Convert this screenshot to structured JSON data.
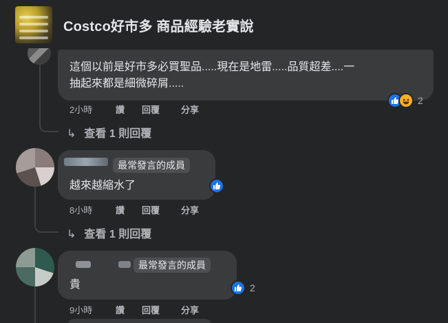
{
  "header": {
    "group_name": "Costco好市多 商品經驗老實說"
  },
  "comments": [
    {
      "text_lines": [
        "這個以前是好市多必買聖品.....現在是地雷.....品質超差....一",
        "抽起來都是細微碎屑....."
      ],
      "time": "2小時",
      "actions": [
        "讚",
        "回覆",
        "分享"
      ],
      "reactions": {
        "icons": [
          "like-icon",
          "haha-icon"
        ],
        "count": "2"
      },
      "view_replies": "查看 1 則回覆"
    },
    {
      "badge": "最常發言的成員",
      "text": "越來越縮水了",
      "time": "8小時",
      "actions": [
        "讚",
        "回覆",
        "分享"
      ],
      "reactions": {
        "icons": [
          "like-icon"
        ],
        "count": ""
      },
      "view_replies": "查看 1 則回覆"
    },
    {
      "badge": "最常發言的成員",
      "text": "貴",
      "time": "9小時",
      "actions": [
        "讚",
        "回覆",
        "分享"
      ],
      "reactions": {
        "icons": [
          "like-icon"
        ],
        "count": "2"
      }
    }
  ],
  "colors": {
    "background": "#242526",
    "bubble": "#3a3b3c",
    "like_blue": "#1b74e4",
    "haha_yellow": "#f7b125",
    "secondary_text": "#b0b3b8"
  }
}
